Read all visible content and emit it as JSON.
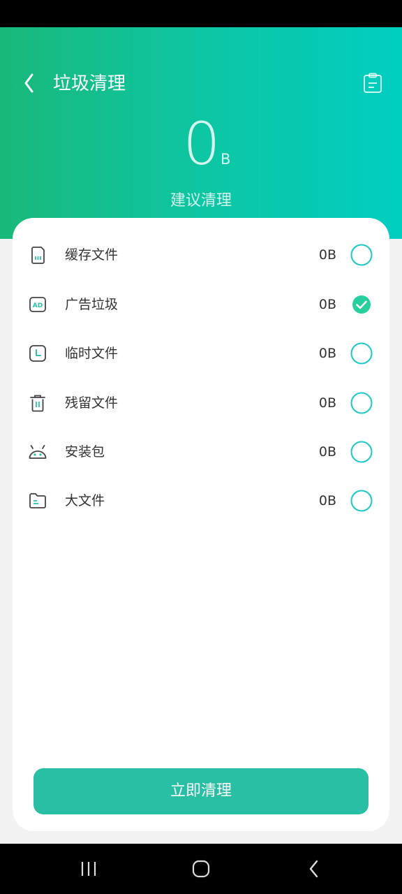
{
  "header": {
    "title": "垃圾清理",
    "back_icon": "chevron-left-icon",
    "record_icon": "clipboard-icon"
  },
  "summary": {
    "value": "0",
    "unit": "B",
    "subtitle": "建议清理"
  },
  "items": [
    {
      "label": "缓存文件",
      "size": "0B",
      "icon": "sd-card-icon",
      "checked": false
    },
    {
      "label": "广告垃圾",
      "size": "0B",
      "icon": "ad-icon",
      "checked": true
    },
    {
      "label": "临时文件",
      "size": "0B",
      "icon": "clock-icon",
      "checked": false
    },
    {
      "label": "残留文件",
      "size": "0B",
      "icon": "trash-icon",
      "checked": false
    },
    {
      "label": "安装包",
      "size": "0B",
      "icon": "android-icon",
      "checked": false
    },
    {
      "label": "大文件",
      "size": "0B",
      "icon": "folder-icon",
      "checked": false
    }
  ],
  "clean_button": {
    "label": "立即清理"
  },
  "colors": {
    "accent": "#29bfa5",
    "check": "#27cf9f",
    "ring": "#1dc9c6",
    "hero_start": "#19b97a",
    "hero_end": "#00cfc0"
  }
}
